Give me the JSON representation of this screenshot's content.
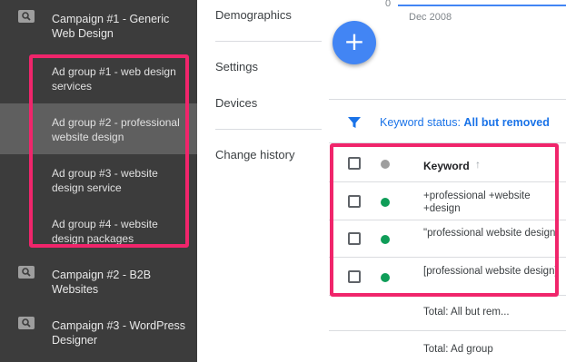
{
  "sidebar": {
    "campaigns": [
      {
        "label": "Campaign #1 - Generic Web Design",
        "icon": "search-icon"
      },
      {
        "label": "Campaign #2 - B2B Websites",
        "icon": "search-icon"
      },
      {
        "label": "Campaign #3 - WordPress Designer",
        "icon": "search-icon"
      }
    ],
    "ad_groups": [
      {
        "label": "Ad group #1 - web design services",
        "selected": false
      },
      {
        "label": "Ad group #2 - professional website design",
        "selected": true
      },
      {
        "label": "Ad group #3 - website design service",
        "selected": false
      },
      {
        "label": "Ad group #4 - website design packages",
        "selected": false
      }
    ]
  },
  "nav": {
    "items": [
      "Demographics",
      "Settings",
      "Devices",
      "Change history"
    ]
  },
  "chart": {
    "y_zero": "0",
    "x_label": "Dec 2008"
  },
  "fab": {
    "label": "+"
  },
  "filter": {
    "prefix": "Keyword status:",
    "value": "All but removed"
  },
  "table": {
    "header": {
      "keyword": "Keyword",
      "sort_icon": "↑"
    },
    "rows": [
      {
        "keyword": "+professional +website +design",
        "status_color": "#0f9d58"
      },
      {
        "keyword": "\"professional website design\"",
        "status_color": "#0f9d58"
      },
      {
        "keyword": "[professional website design]",
        "status_color": "#0f9d58"
      }
    ],
    "totals": [
      "Total: All but rem...",
      "Total: Ad group"
    ]
  },
  "colors": {
    "highlight": "#f0256b",
    "accent": "#1a73e8",
    "status_enabled": "#0f9d58",
    "status_header": "#9e9e9e"
  }
}
